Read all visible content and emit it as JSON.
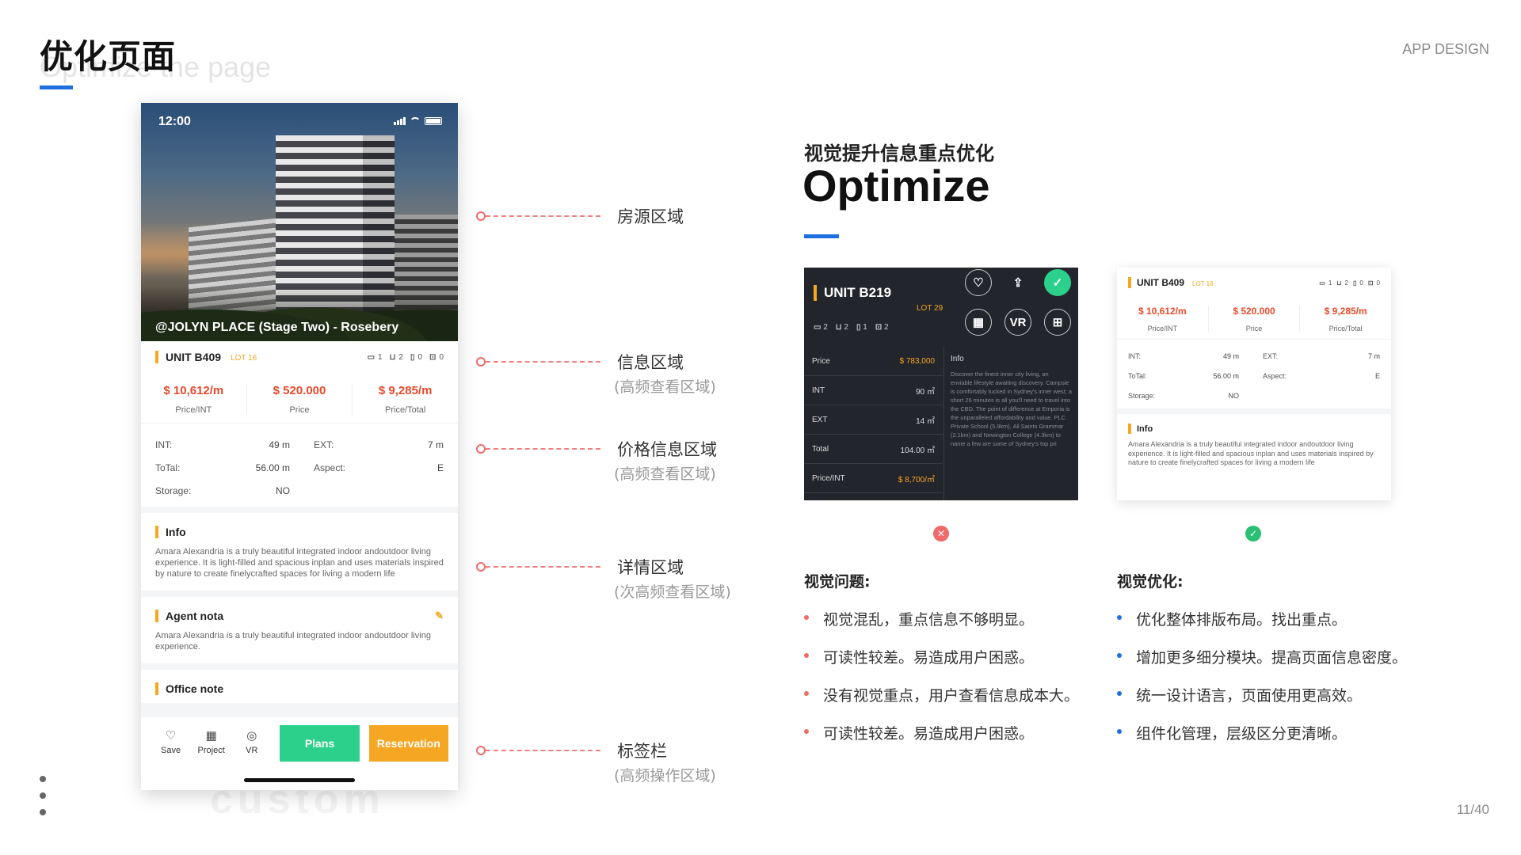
{
  "header": {
    "title": "优化页面",
    "subtitle": "Optimize the page",
    "tag": "APP DESIGN",
    "page_number": "11/40",
    "watermark": "custom"
  },
  "phone": {
    "status_time": "12:00",
    "hero_caption": "@JOLYN PLACE (Stage Two) - Rosebery",
    "unit": "UNIT B409",
    "lot": "LOT 16",
    "specs": [
      {
        "icon": "bed-icon",
        "value": "1"
      },
      {
        "icon": "bath-icon",
        "value": "2"
      },
      {
        "icon": "study-icon",
        "value": "0"
      },
      {
        "icon": "car-icon",
        "value": "0"
      }
    ],
    "prices": [
      {
        "value": "$ 10,612/m",
        "label": "Price/INT"
      },
      {
        "value": "$ 520.000",
        "label": "Price"
      },
      {
        "value": "$ 9,285/m",
        "label": "Price/Total"
      }
    ],
    "details": {
      "int_label": "INT:",
      "int_value": "49 m",
      "ext_label": "EXT:",
      "ext_value": "7 m",
      "total_label": "ToTal:",
      "total_value": "56.00 m",
      "aspect_label": "Aspect:",
      "aspect_value": "E",
      "storage_label": "Storage:",
      "storage_value": "NO"
    },
    "info_title": "Info",
    "info_body": "Amara Alexandria is a truly beautiful integrated indoor andoutdoor living experience. It is light-filled and spacious inplan and uses materials inspired by nature to create finelycrafted spaces for living a modern life",
    "agent_title": "Agent nota",
    "agent_body": "Amara Alexandria is a truly beautiful integrated indoor andoutdoor living experience.",
    "office_title": "Office note",
    "tabs": {
      "save": "Save",
      "project": "Project",
      "vr": "VR",
      "plans": "Plans",
      "reservation": "Reservation"
    }
  },
  "callouts": [
    {
      "title": "房源区域",
      "note": ""
    },
    {
      "title": "信息区域",
      "note": "(高频查看区域)"
    },
    {
      "title": "价格信息区域",
      "note": "(高频查看区域)"
    },
    {
      "title": "详情区域",
      "note": "(次高频查看区域)"
    },
    {
      "title": "标签栏",
      "note": "(高频操作区域)"
    }
  ],
  "optimize": {
    "cn_title": "视觉提升信息重点优化",
    "en_title": "Optimize"
  },
  "dark_card": {
    "unit": "UNIT B219",
    "lot": "LOT 29",
    "specs": [
      "2",
      "2",
      "1",
      "2"
    ],
    "vr_label": "VR",
    "rows": [
      {
        "label": "Price",
        "value": "$ 783,000"
      },
      {
        "label": "INT",
        "value": "90 ㎡"
      },
      {
        "label": "EXT",
        "value": "14 ㎡"
      },
      {
        "label": "Total",
        "value": "104.00 ㎡"
      },
      {
        "label": "Price/INT",
        "value": "$ 8,700/㎡"
      }
    ],
    "info_title": "Info",
    "info_body": "Discover the finest inner city living, an enviable lifestyle awaiting discovery. Campsie is comfortably tucked in Sydney's inner west; a short 26 minutes is all you'll need to travel into the CBD. The point of difference at Emporia is the unparalleled affordability and value. PLC Private School (5.9km), All Saints Grammar (2.1km) and Newington College (4.3km) to name a few are some of Sydney's top pri"
  },
  "light_card": {
    "unit": "UNIT B409",
    "lot": "LOT 16",
    "specs": [
      "1",
      "2",
      "0",
      "0"
    ],
    "prices": [
      {
        "value": "$ 10,612/m",
        "label": "Price/INT"
      },
      {
        "value": "$ 520.000",
        "label": "Price"
      },
      {
        "value": "$ 9,285/m",
        "label": "Price/Total"
      }
    ],
    "details": {
      "int_label": "INT:",
      "int_value": "49 m",
      "ext_label": "EXT:",
      "ext_value": "7 m",
      "total_label": "ToTal:",
      "total_value": "56.00 m",
      "aspect_label": "Aspect:",
      "aspect_value": "E",
      "storage_label": "Storage:",
      "storage_value": "NO"
    },
    "info_title": "Info",
    "info_body": "Amara Alexandria is a truly beautiful integrated indoor andoutdoor living experience. It is light-filled and spacious inplan and uses materials inspired by nature to create finelycrafted spaces for living a modern life"
  },
  "problems": {
    "title": "视觉问题:",
    "items": [
      "视觉混乱，重点信息不够明显。",
      "可读性较差。易造成用户困惑。",
      "没有视觉重点，用户查看信息成本大。",
      "可读性较差。易造成用户困惑。"
    ]
  },
  "improvements": {
    "title": "视觉优化:",
    "items": [
      "优化整体排版布局。找出重点。",
      "增加更多细分模块。提高页面信息密度。",
      "统一设计语言，页面使用更高效。",
      "组件化管理，层级区分更清晰。"
    ]
  },
  "colors": {
    "accent_blue": "#1f6fe0",
    "accent_orange": "#f5a623",
    "price_red": "#e84a2c",
    "plans_green": "#2bd18a",
    "callout_red": "#f06a6a"
  }
}
